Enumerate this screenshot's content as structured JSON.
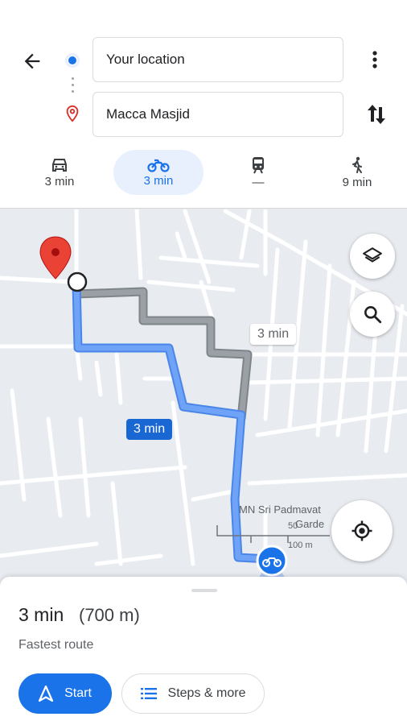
{
  "search": {
    "origin_value": "Your location",
    "destination_value": "Macca Masjid"
  },
  "modes": [
    {
      "name": "car-icon",
      "time": "3 min",
      "active": false
    },
    {
      "name": "motorcycle-icon",
      "time": "3 min",
      "active": true
    },
    {
      "name": "train-icon",
      "time": "—",
      "active": false
    },
    {
      "name": "walk-icon",
      "time": "9 min",
      "active": false
    }
  ],
  "map": {
    "alt_route_time": "3 min",
    "main_route_time": "3 min",
    "poi_label_line1": "MN Sri Padmavat",
    "poi_label_line2": "Garde",
    "scale_top": "50",
    "scale_bottom": "100 m"
  },
  "sheet": {
    "duration": "3 min",
    "distance": "(700 m)",
    "description": "Fastest route",
    "start_label": "Start",
    "steps_label": "Steps & more"
  },
  "colors": {
    "route_primary": "#1a73e8",
    "route_alt": "#9aa0a6",
    "destination_pin": "#d93025"
  }
}
